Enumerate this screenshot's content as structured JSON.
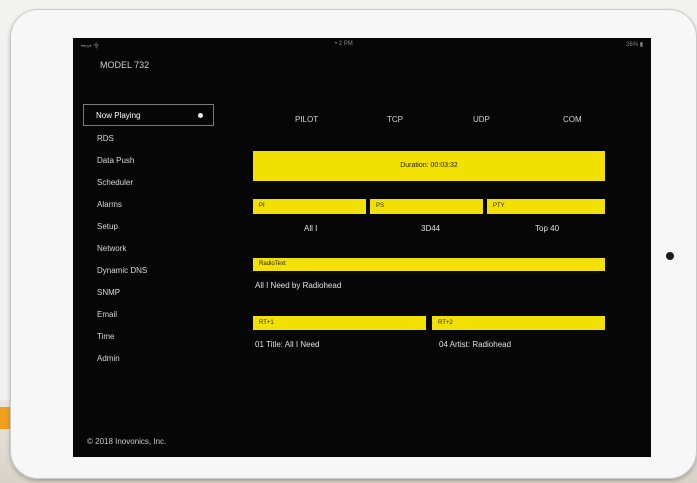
{
  "status_bar": {
    "left": "••∞• 令",
    "center": "• 2 PM",
    "right": "26% ▮"
  },
  "app_title": "MODEL 732",
  "sidebar": {
    "items": [
      {
        "label": "Now Playing"
      },
      {
        "label": "RDS"
      },
      {
        "label": "Data Push"
      },
      {
        "label": "Scheduler"
      },
      {
        "label": "Alarms"
      },
      {
        "label": "Setup"
      },
      {
        "label": "Network"
      },
      {
        "label": "Dynamic DNS"
      },
      {
        "label": "SNMP"
      },
      {
        "label": "Email"
      },
      {
        "label": "Time"
      },
      {
        "label": "Admin"
      }
    ]
  },
  "tabs": [
    {
      "label": "PILOT"
    },
    {
      "label": "TCP"
    },
    {
      "label": "UDP"
    },
    {
      "label": "COM"
    }
  ],
  "duration": {
    "label": "Duration: 00:03:32"
  },
  "fields": {
    "pi": {
      "label": "PI",
      "value": "All I"
    },
    "ps": {
      "label": "PS",
      "value": "3D44"
    },
    "pty": {
      "label": "PTY",
      "value": "Top 40"
    }
  },
  "radiotext": {
    "label": "RadioText",
    "value": "All I Need by Radiohead"
  },
  "rtplus": {
    "tag1": {
      "label": "RT+1",
      "value": "01 Title: All I Need"
    },
    "tag2": {
      "label": "RT+2",
      "value": "04 Artist: Radiohead"
    }
  },
  "footer": "© 2018 Inovonics, Inc.",
  "colors": {
    "accent": "#f2e000",
    "screen_bg": "#060606",
    "case_accent": "#f0a01c"
  }
}
